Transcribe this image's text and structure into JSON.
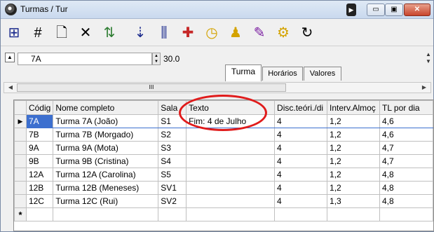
{
  "window": {
    "title": "Turmas / Tur"
  },
  "titlebar": {
    "arrow_glyph": "▶",
    "min_glyph": "▭",
    "max_glyph": "▣",
    "close_glyph": "✕"
  },
  "toolbar": {
    "items": [
      {
        "icon": "grid-select-icon",
        "glyph": "⊞",
        "color": "#1b2a8c"
      },
      {
        "icon": "hash-icon",
        "glyph": "#",
        "color": "#000"
      },
      {
        "icon": "new-document-icon",
        "glyph": "🗋",
        "color": "#000"
      },
      {
        "icon": "delete-icon",
        "glyph": "✕",
        "color": "#000"
      },
      {
        "icon": "shuffle-icon",
        "glyph": "⇅",
        "color": "#2e7d32"
      },
      {
        "icon": "sort-az-icon",
        "glyph": "⇣",
        "color": "#1b2a8c"
      },
      {
        "icon": "columns-icon",
        "glyph": "⫼",
        "color": "#1b2a8c"
      },
      {
        "icon": "puzzle-icon",
        "glyph": "✚",
        "color": "#c62828"
      },
      {
        "icon": "clock-icon",
        "glyph": "◷",
        "color": "#d4a300"
      },
      {
        "icon": "teacher-table-icon",
        "glyph": "♟",
        "color": "#d4a300"
      },
      {
        "icon": "paint-icon",
        "glyph": "✎",
        "color": "#7b1fa2"
      },
      {
        "icon": "gears-icon",
        "glyph": "⚙",
        "color": "#d4a300"
      },
      {
        "icon": "refresh-icon",
        "glyph": "↻",
        "color": "#000"
      }
    ]
  },
  "form": {
    "code_value": "7A",
    "number_value": "30.0",
    "tabs": [
      "Turma",
      "Horários",
      "Valores"
    ],
    "active_tab": "Turma",
    "scroll_grip": "III"
  },
  "grid": {
    "columns": [
      "Códig",
      "Nome completo",
      "Sala",
      "Texto",
      "Disc.teóri./di",
      "Interv.Almoç",
      "TL por dia"
    ],
    "rows": [
      {
        "code": "7A",
        "name": "Turma 7A (João)",
        "room": "S1",
        "text": "Fim: 4 de Julho",
        "disc": "4",
        "interv": "1,2",
        "tl": "4,6",
        "selected": true
      },
      {
        "code": "7B",
        "name": "Turma 7B (Morgado)",
        "room": "S2",
        "text": "",
        "disc": "4",
        "interv": "1,2",
        "tl": "4,6"
      },
      {
        "code": "9A",
        "name": "Turma 9A (Mota)",
        "room": "S3",
        "text": "",
        "disc": "4",
        "interv": "1,2",
        "tl": "4,7"
      },
      {
        "code": "9B",
        "name": "Turma 9B (Cristina)",
        "room": "S4",
        "text": "",
        "disc": "4",
        "interv": "1,2",
        "tl": "4,7"
      },
      {
        "code": "12A",
        "name": "Turma 12A (Carolina)",
        "room": "S5",
        "text": "",
        "disc": "4",
        "interv": "1,2",
        "tl": "4,8"
      },
      {
        "code": "12B",
        "name": "Turma 12B (Meneses)",
        "room": "SV1",
        "text": "",
        "disc": "4",
        "interv": "1,2",
        "tl": "4,8"
      },
      {
        "code": "12C",
        "name": "Turma 12C (Rui)",
        "room": "SV2",
        "text": "",
        "disc": "4",
        "interv": "1,3",
        "tl": "4,8"
      }
    ],
    "current_row_marker": "▶",
    "new_row_marker": "*"
  },
  "colors": {
    "selection": "#3c6fcf",
    "highlight_circle": "#e01b1b"
  }
}
